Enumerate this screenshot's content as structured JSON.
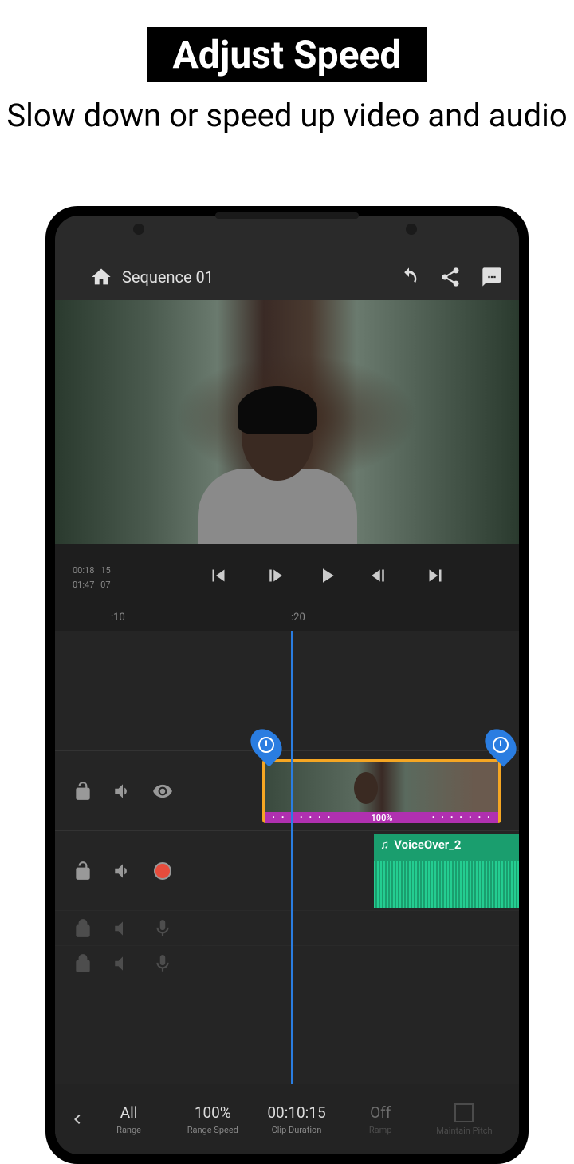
{
  "promo": {
    "title": "Adjust Speed",
    "subtitle": "Slow down or speed up video and audio"
  },
  "topbar": {
    "title": "Sequence 01"
  },
  "transport": {
    "current_time": "00:18",
    "current_frame": "15",
    "total_time": "01:47",
    "total_frame": "07"
  },
  "ruler": {
    "mark1": ":10",
    "mark2": ":20"
  },
  "clip": {
    "speed_label": "100%"
  },
  "audio": {
    "label": "VoiceOver_2"
  },
  "bottom": {
    "range": {
      "val": "All",
      "lbl": "Range"
    },
    "speed": {
      "val": "100%",
      "lbl": "Range Speed"
    },
    "duration": {
      "val": "00:10:15",
      "lbl": "Clip Duration"
    },
    "ramp": {
      "val": "Off",
      "lbl": "Ramp"
    },
    "pitch": {
      "lbl": "Maintain Pitch"
    }
  }
}
